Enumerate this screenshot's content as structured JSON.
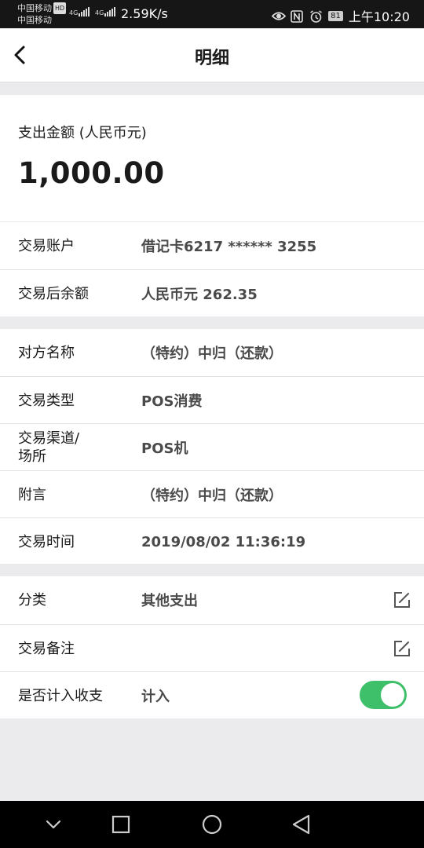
{
  "status_bar": {
    "carrier1": "中国移动",
    "carrier2": "中国移动",
    "hd_badge": "HD",
    "network1": "4G",
    "network2": "4G",
    "speed": "2.59K/s",
    "battery": "81",
    "time": "上午10:20",
    "icons": [
      "eye-icon",
      "nfc-icon",
      "alarm-icon",
      "battery-icon"
    ]
  },
  "header": {
    "title": "明细",
    "back_icon": "chevron-left-icon"
  },
  "amount": {
    "label": "支出金额 (人民币元)",
    "value": "1,000.00"
  },
  "account_section": [
    {
      "label": "交易账户",
      "value": "借记卡6217 ****** 3255"
    },
    {
      "label": "交易后余额",
      "value": "人民币元 262.35"
    }
  ],
  "detail_section": [
    {
      "label": "对方名称",
      "value": "（特约）中归（还款）"
    },
    {
      "label": "交易类型",
      "value": "POS消费"
    },
    {
      "label": "交易渠道/\n场所",
      "value": "POS机"
    },
    {
      "label": "附言",
      "value": "（特约）中归（还款）"
    },
    {
      "label": "交易时间",
      "value": "2019/08/02 11:36:19"
    }
  ],
  "settings_section": {
    "category": {
      "label": "分类",
      "value": "其他支出",
      "icon": "edit-icon"
    },
    "remark": {
      "label": "交易备注",
      "value": "",
      "icon": "edit-icon"
    },
    "include": {
      "label": "是否计入收支",
      "value": "计入",
      "toggle_on": true
    }
  },
  "colors": {
    "toggle_on": "#3ec06a",
    "page_bg": "#ebebee",
    "value_text": "#4a4a4a"
  },
  "nav_bar": [
    "chevron-down-icon",
    "square-icon",
    "circle-icon",
    "triangle-back-icon"
  ]
}
